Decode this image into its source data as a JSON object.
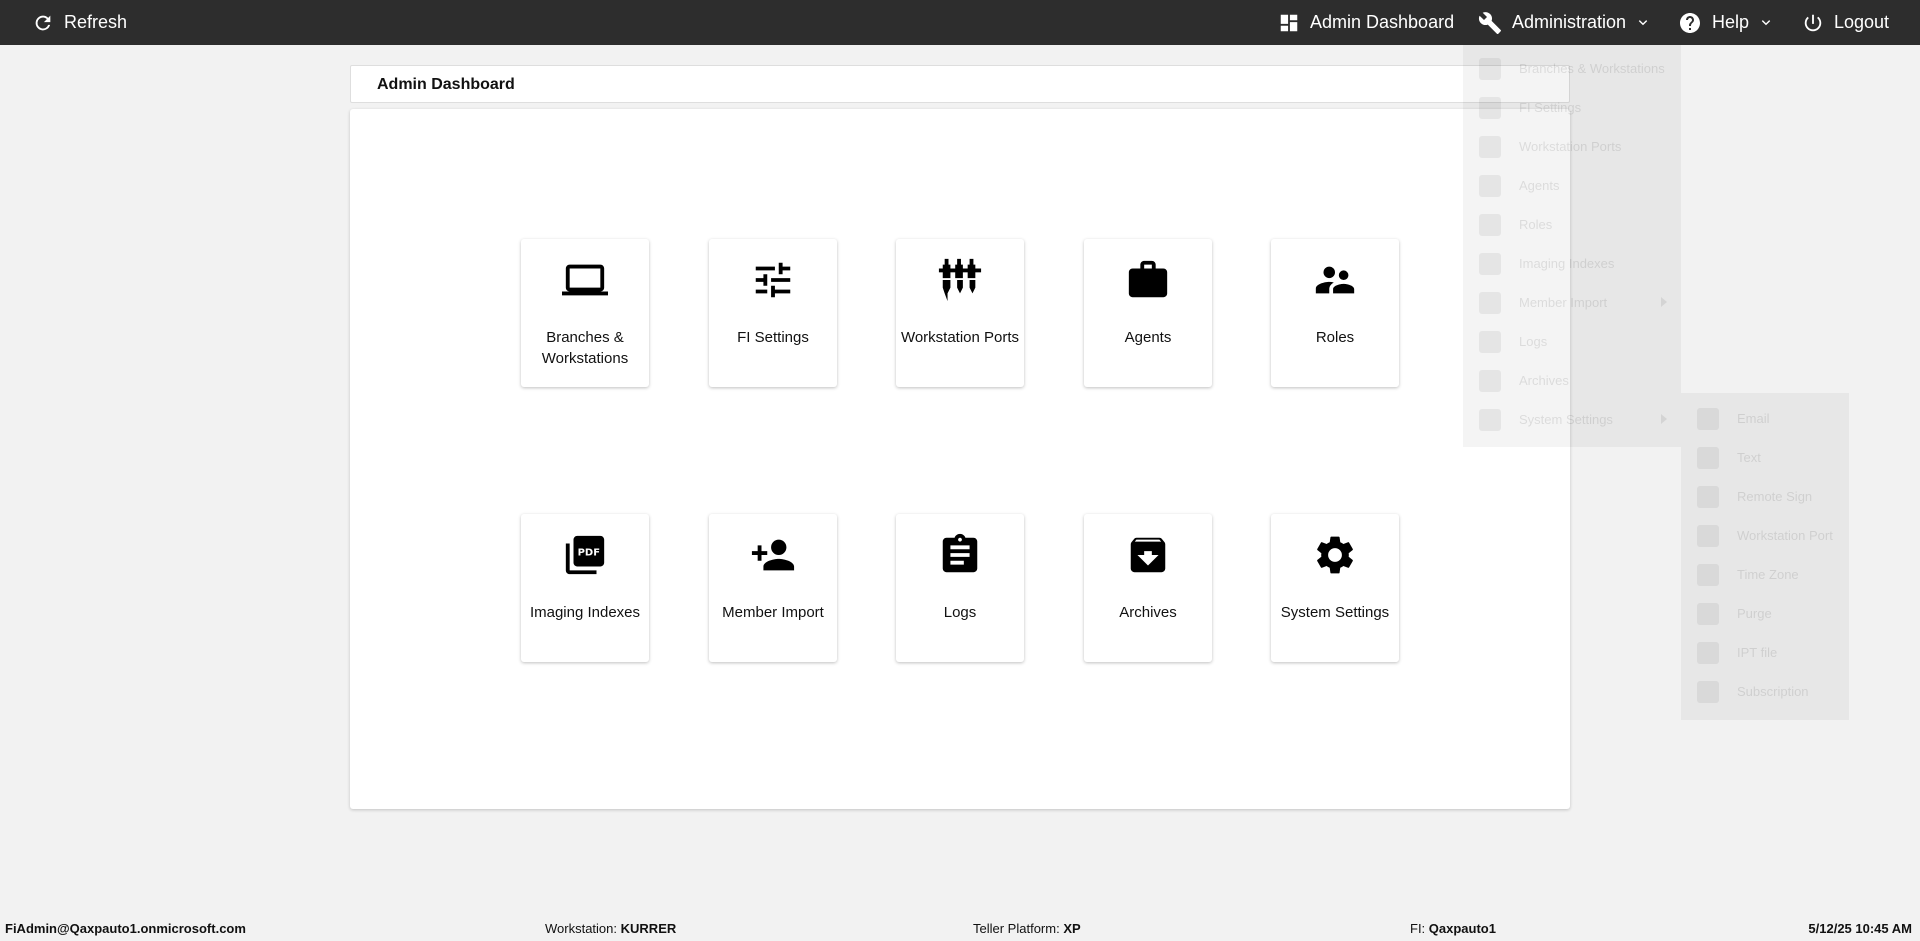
{
  "topbar": {
    "refresh_label": "Refresh",
    "admin_dashboard_label": "Admin Dashboard",
    "administration_label": "Administration",
    "help_label": "Help",
    "logout_label": "Logout",
    "background_color": "#2d2d2d"
  },
  "header": {
    "title": "Admin Dashboard"
  },
  "tiles": [
    {
      "label": "Branches & Workstations",
      "icon": "laptop-icon"
    },
    {
      "label": "FI Settings",
      "icon": "sliders-icon"
    },
    {
      "label": "Workstation Ports",
      "icon": "ports-icon"
    },
    {
      "label": "Agents",
      "icon": "briefcase-icon"
    },
    {
      "label": "Roles",
      "icon": "people-icon"
    },
    {
      "label": "Imaging Indexes",
      "icon": "pdf-icon"
    },
    {
      "label": "Member Import",
      "icon": "person-add-icon"
    },
    {
      "label": "Logs",
      "icon": "clipboard-icon"
    },
    {
      "label": "Archives",
      "icon": "archive-icon"
    },
    {
      "label": "System Settings",
      "icon": "gear-icon"
    }
  ],
  "admin_menu": [
    {
      "label": "Branches & Workstations"
    },
    {
      "label": "FI Settings"
    },
    {
      "label": "Workstation Ports"
    },
    {
      "label": "Agents"
    },
    {
      "label": "Roles"
    },
    {
      "label": "Imaging Indexes"
    },
    {
      "label": "Member Import",
      "has_submenu": true
    },
    {
      "label": "Logs"
    },
    {
      "label": "Archives"
    },
    {
      "label": "System Settings",
      "has_submenu": true
    }
  ],
  "system_settings_menu": [
    {
      "label": "Email"
    },
    {
      "label": "Text"
    },
    {
      "label": "Remote Sign"
    },
    {
      "label": "Workstation Port"
    },
    {
      "label": "Time Zone"
    },
    {
      "label": "Purge"
    },
    {
      "label": "IPT file"
    },
    {
      "label": "Subscription"
    }
  ],
  "status": {
    "user": "FiAdmin@Qaxpauto1.onmicrosoft.com",
    "workstation_label": "Workstation:",
    "workstation_value": "KURRER",
    "teller_label": "Teller Platform:",
    "teller_value": "XP",
    "fi_label": "FI:",
    "fi_value": "Qaxpauto1",
    "datetime": "5/12/25 10:45 AM"
  }
}
